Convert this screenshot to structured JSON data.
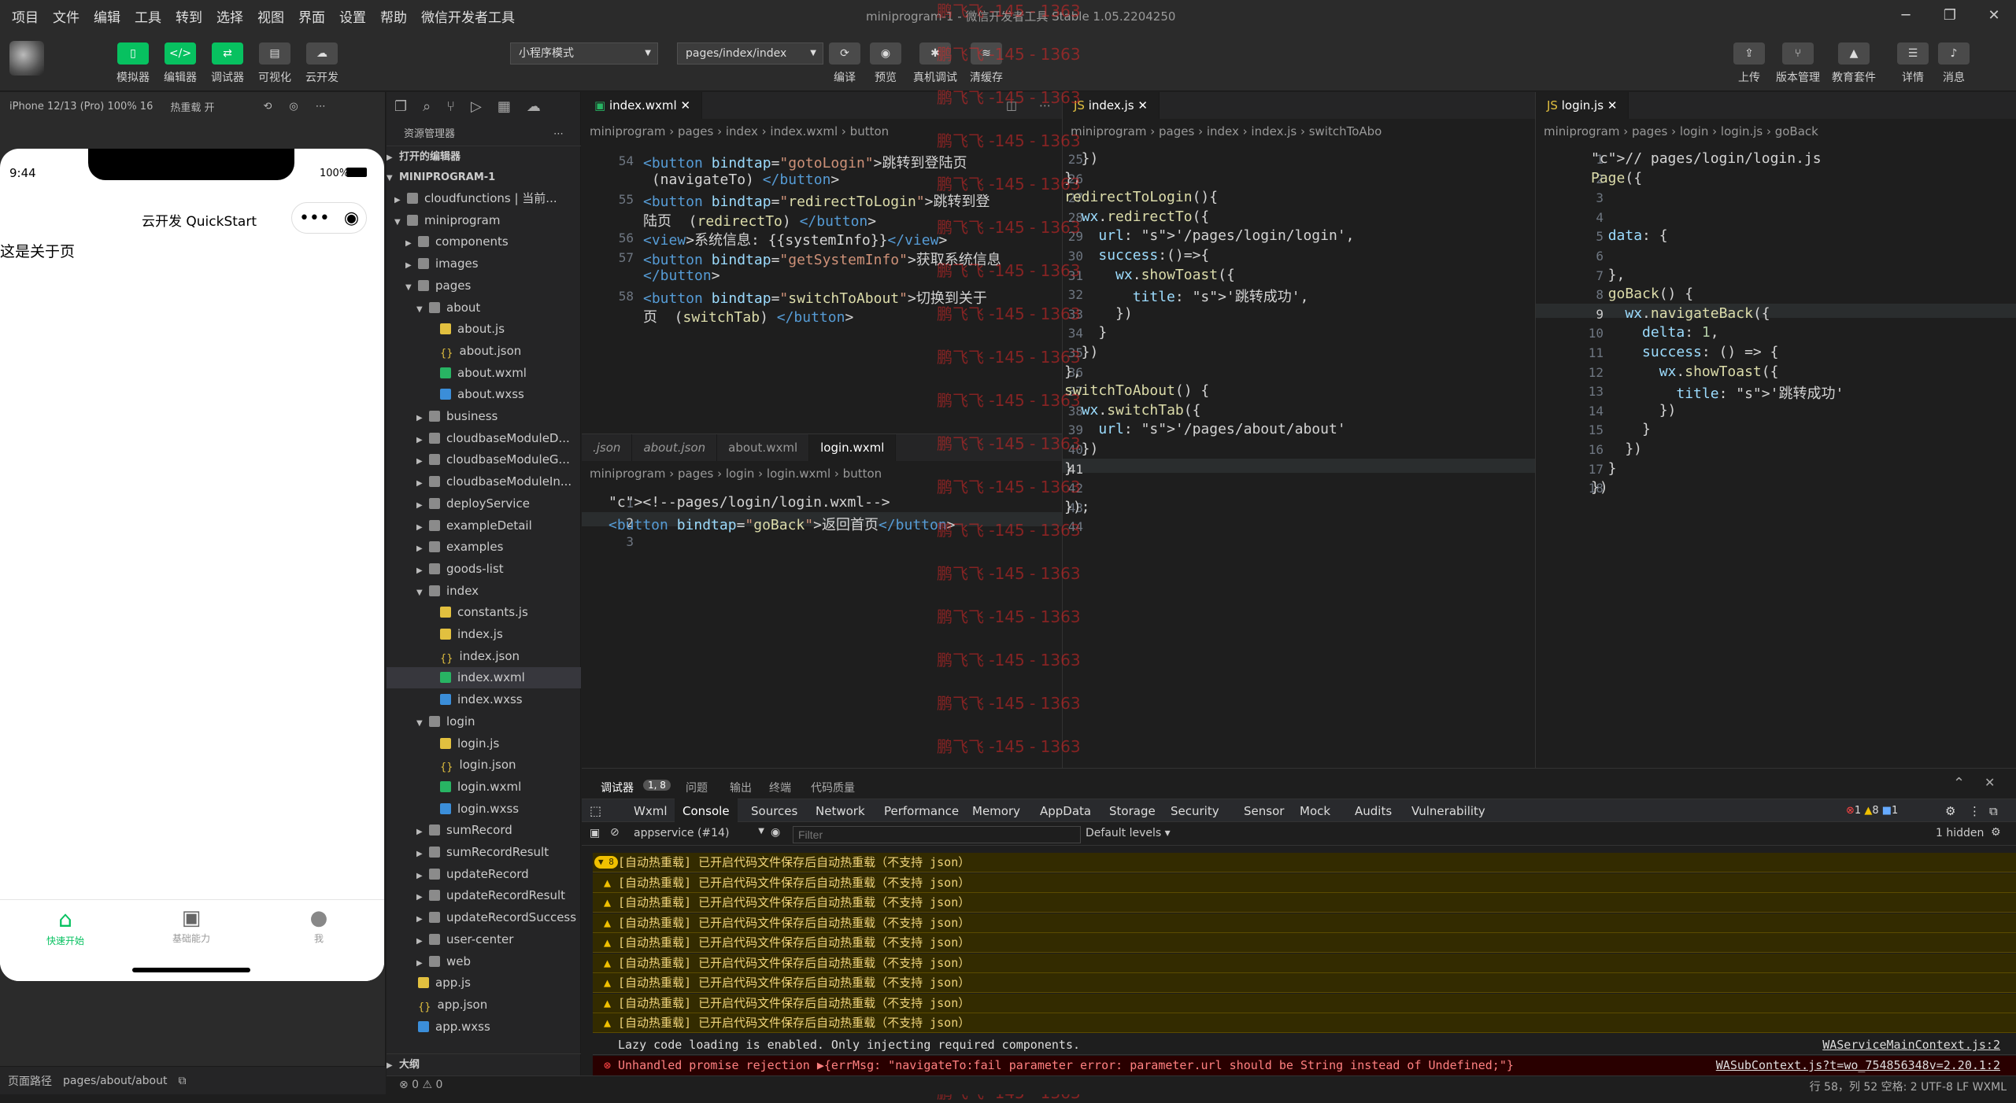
{
  "menu": [
    "项目",
    "文件",
    "编辑",
    "工具",
    "转到",
    "选择",
    "视图",
    "界面",
    "设置",
    "帮助",
    "微信开发者工具"
  ],
  "window_title": "miniprogram-1 - 微信开发者工具 Stable 1.05.2204250",
  "toolbar": {
    "left": [
      "模拟器",
      "编辑器",
      "调试器",
      "可视化",
      "云开发"
    ],
    "mode_select": "小程序模式",
    "page_select": "pages/index/index",
    "mid": [
      "编译",
      "预览",
      "真机调试",
      "清缓存"
    ],
    "right": [
      "上传",
      "版本管理",
      "教育套件",
      "详情",
      "消息"
    ]
  },
  "simulator": {
    "device": "iPhone 12/13 (Pro) 100% 16",
    "hot_reload": "热重载 开",
    "time": "9:44",
    "battery": "100%",
    "nav_title": "云开发 QuickStart",
    "body_text": "这是关于页",
    "tabs": [
      "快速开始",
      "基础能力",
      "我"
    ],
    "footer_path_label": "页面路径",
    "footer_path": "pages/about/about"
  },
  "explorer": {
    "title": "资源管理器",
    "open_editors": "打开的编辑器",
    "root": "MINIPROGRAM-1",
    "outline": "大纲",
    "items": [
      "cloudfunctions | 当前...",
      "miniprogram",
      "components",
      "images",
      "pages",
      "about",
      "about.js",
      "about.json",
      "about.wxml",
      "about.wxss",
      "business",
      "cloudbaseModuleD...",
      "cloudbaseModuleG...",
      "cloudbaseModuleIn...",
      "deployService",
      "exampleDetail",
      "examples",
      "goods-list",
      "index",
      "constants.js",
      "index.js",
      "index.json",
      "index.wxml",
      "index.wxss",
      "login",
      "login.js",
      "login.json",
      "login.wxml",
      "login.wxss",
      "sumRecord",
      "sumRecordResult",
      "updateRecord",
      "updateRecordResult",
      "updateRecordSuccess",
      "user-center",
      "web",
      "app.js",
      "app.json",
      "app.wxss"
    ]
  },
  "editor1": {
    "tab": "index.wxml",
    "breadcrumb": "miniprogram › pages › index › index.wxml › button",
    "lines": [
      {
        "n": "54",
        "t": "<button bindtap=\"gotoLogin\">跳转到登陆页"
      },
      {
        "n": "",
        "t": " (navigateTo) </button>"
      },
      {
        "n": "55",
        "t": "<button bindtap=\"redirectToLogin\">跳转到登"
      },
      {
        "n": "",
        "t": "陆页  (redirectTo) </button>"
      },
      {
        "n": "56",
        "t": "<view>系统信息: {{systemInfo}}</view>"
      },
      {
        "n": "57",
        "t": "<button bindtap=\"getSystemInfo\">获取系统信息"
      },
      {
        "n": "",
        "t": "</button>"
      },
      {
        "n": "58",
        "t": "<button bindtap=\"switchToAbout\">切换到关于"
      },
      {
        "n": "",
        "t": "页  (switchTab) </button>"
      }
    ]
  },
  "editor1b": {
    "tabs": [
      ".json",
      "about.json",
      "about.wxml",
      "login.wxml"
    ],
    "breadcrumb": "miniprogram › pages › login › login.wxml › button",
    "lines": [
      {
        "n": "1",
        "t": "<!--pages/login/login.wxml-->"
      },
      {
        "n": "2",
        "t": "<button bindtap=\"goBack\">返回首页</button>"
      },
      {
        "n": "3",
        "t": ""
      }
    ]
  },
  "editor2": {
    "tab": "index.js",
    "breadcrumb": "miniprogram › pages › index › index.js › switchToAbo",
    "lines": [
      {
        "n": "25",
        "t": "  })"
      },
      {
        "n": "26",
        "t": "},"
      },
      {
        "n": "27",
        "t": "redirectToLogin(){"
      },
      {
        "n": "28",
        "t": "  wx.redirectTo({"
      },
      {
        "n": "29",
        "t": "    url: '/pages/login/login',"
      },
      {
        "n": "30",
        "t": "    success:()=>{"
      },
      {
        "n": "31",
        "t": "      wx.showToast({"
      },
      {
        "n": "32",
        "t": "        title: '跳转成功',"
      },
      {
        "n": "33",
        "t": "      })"
      },
      {
        "n": "34",
        "t": "    }"
      },
      {
        "n": "35",
        "t": "  })"
      },
      {
        "n": "36",
        "t": "},"
      },
      {
        "n": "37",
        "t": "switchToAbout() {"
      },
      {
        "n": "38",
        "t": "  wx.switchTab({"
      },
      {
        "n": "39",
        "t": "    url: '/pages/about/about'"
      },
      {
        "n": "40",
        "t": "  })"
      },
      {
        "n": "41",
        "t": "}"
      },
      {
        "n": "42",
        "t": ""
      },
      {
        "n": "43",
        "t": "});"
      },
      {
        "n": "44",
        "t": ""
      }
    ]
  },
  "editor3": {
    "tab": "login.js",
    "breadcrumb": "miniprogram › pages › login › login.js › goBack",
    "lines": [
      {
        "n": "1",
        "t": "// pages/login/login.js"
      },
      {
        "n": "2",
        "t": "Page({"
      },
      {
        "n": "3",
        "t": ""
      },
      {
        "n": "4",
        "t": ""
      },
      {
        "n": "5",
        "t": "  data: {"
      },
      {
        "n": "6",
        "t": ""
      },
      {
        "n": "7",
        "t": "  },"
      },
      {
        "n": "8",
        "t": "  goBack() {"
      },
      {
        "n": "9",
        "t": "    wx.navigateBack({"
      },
      {
        "n": "10",
        "t": "      delta: 1,"
      },
      {
        "n": "11",
        "t": "      success: () => {"
      },
      {
        "n": "12",
        "t": "        wx.showToast({"
      },
      {
        "n": "13",
        "t": "          title: '跳转成功'"
      },
      {
        "n": "14",
        "t": "        })"
      },
      {
        "n": "15",
        "t": "      }"
      },
      {
        "n": "16",
        "t": "    })"
      },
      {
        "n": "17",
        "t": "  }"
      },
      {
        "n": "18",
        "t": "})"
      }
    ]
  },
  "watermark": "鹏飞飞 -145 - 1363",
  "debugger": {
    "top_tabs": [
      "调试器",
      "1, 8",
      "问题",
      "输出",
      "终端",
      "代码质量"
    ],
    "panel_tabs": [
      "Wxml",
      "Console",
      "Sources",
      "Network",
      "Performance",
      "Memory",
      "AppData",
      "Storage",
      "Security",
      "Sensor",
      "Mock",
      "Audits",
      "Vulnerability"
    ],
    "active_panel": "Console",
    "counts": {
      "errors": "1",
      "warnings": "8",
      "info": "1"
    },
    "context": "appservice (#14)",
    "filter_placeholder": "Filter",
    "levels": "Default levels",
    "hidden": "1 hidden",
    "badge": "8",
    "warn_text": "[自动热重载] 已开启代码文件保存后自动热重载（不支持 json）",
    "lazy": "Lazy code loading is enabled. Only injecting required components.",
    "lazy_src": "WAServiceMainContext.js:2",
    "error": "Unhandled promise rejection ▶{errMsg: \"navigateTo:fail parameter error: parameter.url should be String instead of Undefined;\"}",
    "error_src": "WASubContext.js?t=wo_754856348v=2.20.1:2"
  },
  "status": {
    "problems": "⊗ 0 ⚠ 0",
    "right": "行 58，列 52   空格: 2   UTF-8   LF   WXML"
  }
}
